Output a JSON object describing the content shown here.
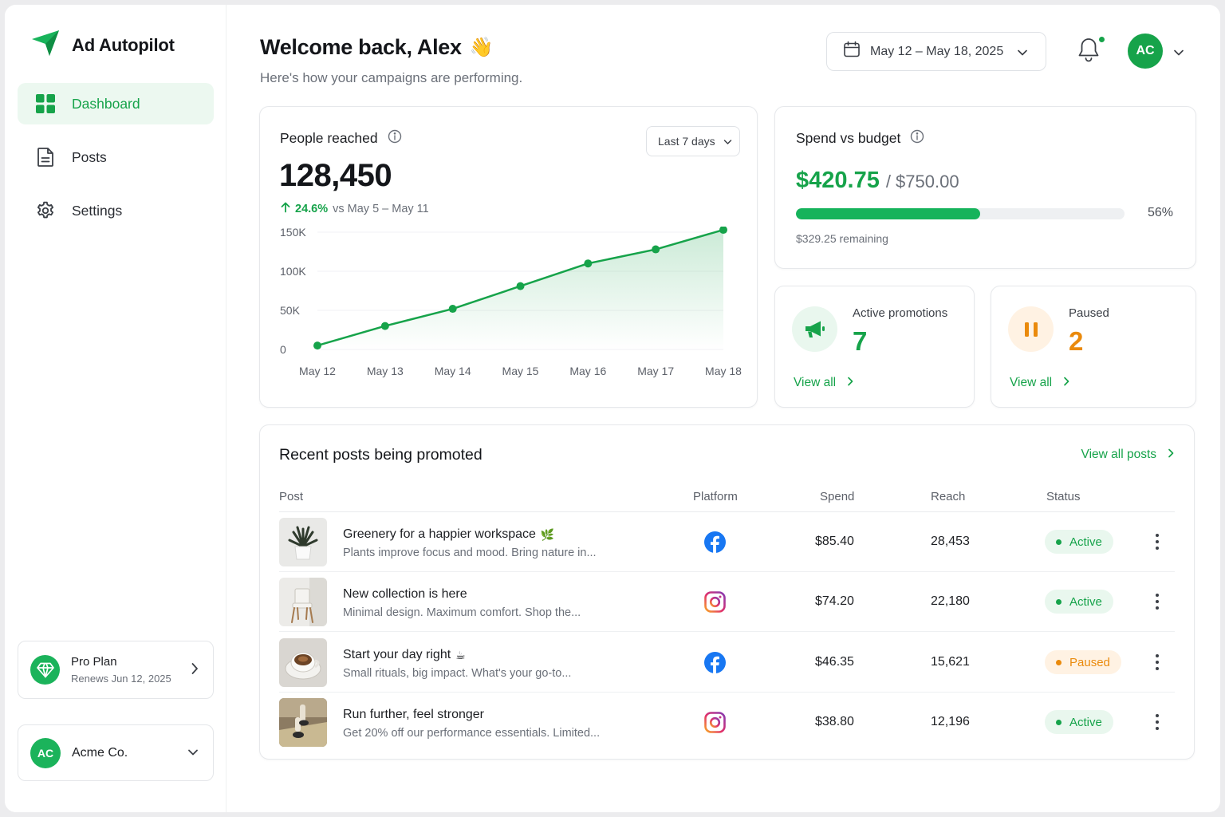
{
  "brand": {
    "name": "Ad Autopilot"
  },
  "nav": [
    {
      "label": "Dashboard",
      "icon": "dashboard-grid-icon",
      "active": true
    },
    {
      "label": "Posts",
      "icon": "document-icon",
      "active": false
    },
    {
      "label": "Settings",
      "icon": "gear-icon",
      "active": false
    }
  ],
  "plan": {
    "title": "Pro Plan",
    "renews": "Renews Jun 12, 2025"
  },
  "org": {
    "initials": "AC",
    "name": "Acme Co."
  },
  "header": {
    "welcome": "Welcome back, Alex",
    "wave": "👋",
    "subtitle": "Here's how your campaigns are performing.",
    "date_range": "May 12 – May 18, 2025",
    "avatar_initials": "AC"
  },
  "reach": {
    "title": "People reached",
    "range": "Last 7 days",
    "total": "128,450",
    "delta_pct": "24.6%",
    "delta_cmp": "vs May 5 – May 11"
  },
  "chart_data": {
    "type": "area",
    "categories": [
      "May 12",
      "May 13",
      "May 14",
      "May 15",
      "May 16",
      "May 17",
      "May 18"
    ],
    "values": [
      5000,
      30000,
      52000,
      81000,
      110000,
      128000,
      153000
    ],
    "yticks": [
      "0",
      "50K",
      "100K",
      "150K"
    ],
    "ylim": [
      0,
      150000
    ],
    "color": "#16a34a"
  },
  "budget": {
    "title": "Spend vs budget",
    "spent": "$420.75",
    "total": "/ $750.00",
    "percent_label": "56%",
    "percent": 56,
    "remaining": "$329.25 remaining"
  },
  "active_promotions": {
    "label": "Active promotions",
    "value": "7",
    "link": "View all"
  },
  "paused": {
    "label": "Paused",
    "value": "2",
    "link": "View all"
  },
  "posts": {
    "title": "Recent posts being promoted",
    "view_all": "View all posts",
    "columns": {
      "post": "Post",
      "platform": "Platform",
      "spend": "Spend",
      "reach": "Reach",
      "status": "Status"
    },
    "rows": [
      {
        "title": "Greenery for a happier workspace",
        "emoji": "🌿",
        "desc": "Plants improve focus and mood. Bring nature in...",
        "platform": "facebook",
        "spend": "$85.40",
        "reach": "28,453",
        "status": "Active",
        "thumb": "plant"
      },
      {
        "title": "New collection is here",
        "emoji": "",
        "desc": "Minimal design. Maximum comfort. Shop the...",
        "platform": "instagram",
        "spend": "$74.20",
        "reach": "22,180",
        "status": "Active",
        "thumb": "chair"
      },
      {
        "title": "Start your day right",
        "emoji": "☕",
        "desc": "Small rituals, big impact. What's your go-to...",
        "platform": "facebook",
        "spend": "$46.35",
        "reach": "15,621",
        "status": "Paused",
        "thumb": "coffee"
      },
      {
        "title": "Run further, feel stronger",
        "emoji": "",
        "desc": "Get 20% off our performance essentials. Limited...",
        "platform": "instagram",
        "spend": "$38.80",
        "reach": "12,196",
        "status": "Active",
        "thumb": "runner"
      }
    ]
  },
  "colors": {
    "accent": "#16a34a",
    "paused": "#ea8a0c",
    "text": "#1d1f23",
    "muted": "#6b7079"
  }
}
